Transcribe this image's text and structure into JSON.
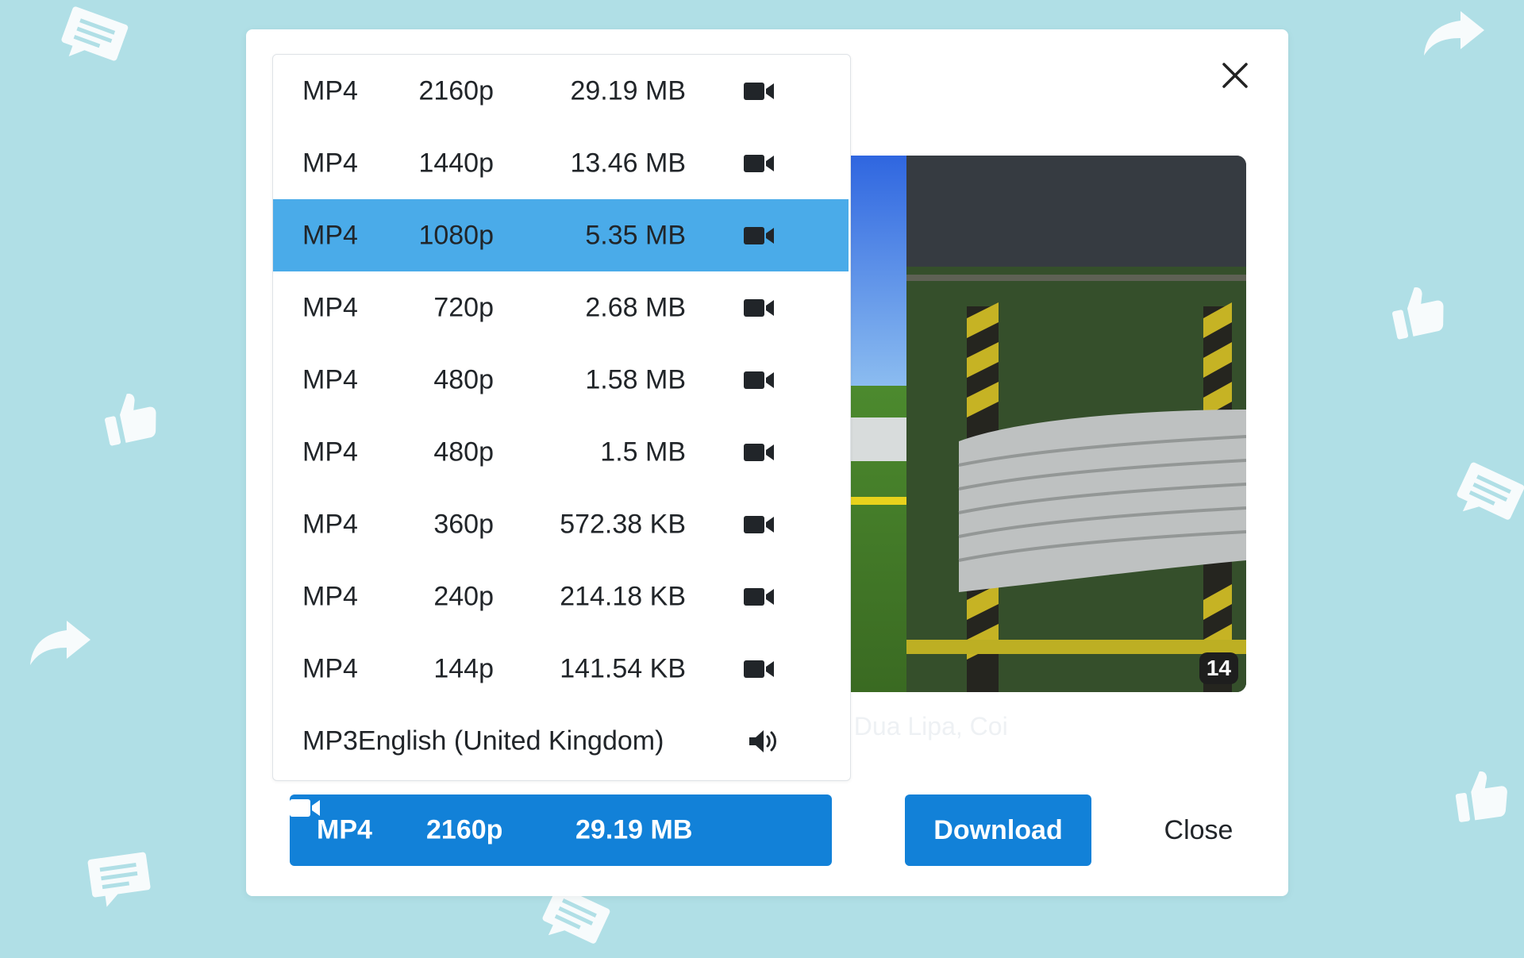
{
  "modal": {
    "options": [
      {
        "format": "MP4",
        "resolution": "2160p",
        "size": "29.19 MB",
        "icon": "video-camera-icon",
        "selected": false
      },
      {
        "format": "MP4",
        "resolution": "1440p",
        "size": "13.46 MB",
        "icon": "video-camera-icon",
        "selected": false
      },
      {
        "format": "MP4",
        "resolution": "1080p",
        "size": "5.35 MB",
        "icon": "video-camera-icon",
        "selected": true
      },
      {
        "format": "MP4",
        "resolution": "720p",
        "size": "2.68 MB",
        "icon": "video-camera-icon",
        "selected": false
      },
      {
        "format": "MP4",
        "resolution": "480p",
        "size": "1.58 MB",
        "icon": "video-camera-icon",
        "selected": false
      },
      {
        "format": "MP4",
        "resolution": "480p",
        "size": "1.5 MB",
        "icon": "video-camera-icon",
        "selected": false
      },
      {
        "format": "MP4",
        "resolution": "360p",
        "size": "572.38 KB",
        "icon": "video-camera-icon",
        "selected": false
      },
      {
        "format": "MP4",
        "resolution": "240p",
        "size": "214.18 KB",
        "icon": "video-camera-icon",
        "selected": false
      },
      {
        "format": "MP4",
        "resolution": "144p",
        "size": "141.54 KB",
        "icon": "video-camera-icon",
        "selected": false
      }
    ],
    "audio_option": {
      "label": "MP3English (United Kingdom)",
      "icon": "speaker-icon"
    },
    "selected": {
      "format": "MP4",
      "resolution": "2160p",
      "size": "29.19 MB",
      "icon": "video-camera-icon"
    },
    "download_label": "Download",
    "close_label": "Close",
    "preview": {
      "duration_badge": "14",
      "caption_partial": ", Dua Lipa, Coi"
    }
  },
  "colors": {
    "background": "#b0dfe6",
    "accent": "#1281d8",
    "highlight": "#4aabe9",
    "text": "#212529"
  }
}
